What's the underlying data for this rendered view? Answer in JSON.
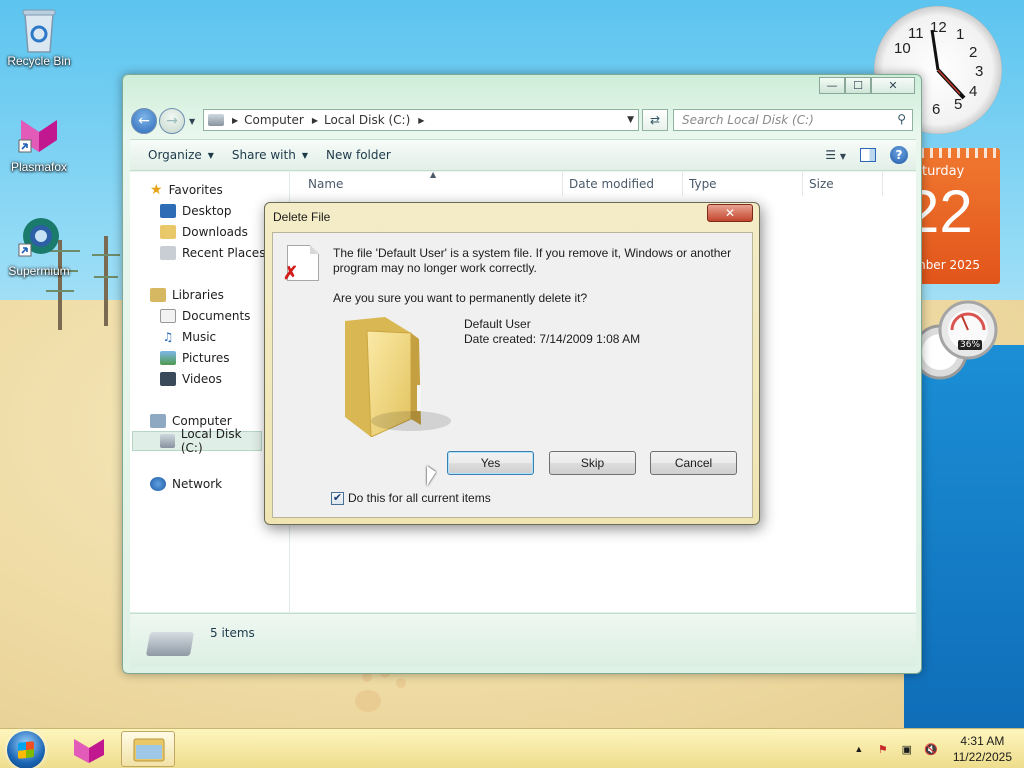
{
  "desktop": {
    "icons": [
      {
        "label": "Recycle Bin"
      },
      {
        "label": "Plasmafox"
      },
      {
        "label": "Supermium"
      }
    ],
    "calendar": {
      "day_name": "aturday",
      "day_number": "22",
      "month_year": "mber 2025"
    },
    "clock_numbers": [
      "12",
      "1",
      "2",
      "3",
      "4",
      "5",
      "6",
      "10",
      "11"
    ],
    "meter_percent": "36%"
  },
  "explorer": {
    "window_controls": {
      "minimize": "—",
      "maximize": "☐",
      "close": "✕"
    },
    "breadcrumbs": [
      "Computer",
      "Local Disk (C:)"
    ],
    "search_placeholder": "Search Local Disk (C:)",
    "toolbar": {
      "organize": "Organize",
      "share_with": "Share with",
      "new_folder": "New folder"
    },
    "nav": {
      "favorites": {
        "label": "Favorites",
        "items": [
          "Desktop",
          "Downloads",
          "Recent Places"
        ]
      },
      "libraries": {
        "label": "Libraries",
        "items": [
          "Documents",
          "Music",
          "Pictures",
          "Videos"
        ]
      },
      "computer": {
        "label": "Computer",
        "items": [
          "Local Disk (C:)"
        ]
      },
      "network": {
        "label": "Network"
      }
    },
    "columns": [
      "Name",
      "Date modified",
      "Type",
      "Size"
    ],
    "status": {
      "items_count": "5 items"
    }
  },
  "dialog": {
    "title": "Delete File",
    "close_label": "✕",
    "message": "The file 'Default User' is a system file. If you remove it, Windows or another program may no longer work correctly.",
    "question": "Are you sure you want to permanently delete it?",
    "file_name": "Default User",
    "file_date": "Date created: 7/14/2009 1:08 AM",
    "buttons": {
      "yes": "Yes",
      "skip": "Skip",
      "cancel": "Cancel"
    },
    "checkbox": {
      "label": "Do this for all current items",
      "checked": true,
      "mark": "✔"
    }
  },
  "taskbar": {
    "time": "4:31 AM",
    "date": "11/22/2025",
    "tray_arrow": "▲"
  },
  "colors": {
    "dialog_frame": "#efe4b2",
    "explorer_frame": "#cdeed8",
    "accent_blue": "#2b69b8",
    "calendar_orange": "#e2551b"
  }
}
